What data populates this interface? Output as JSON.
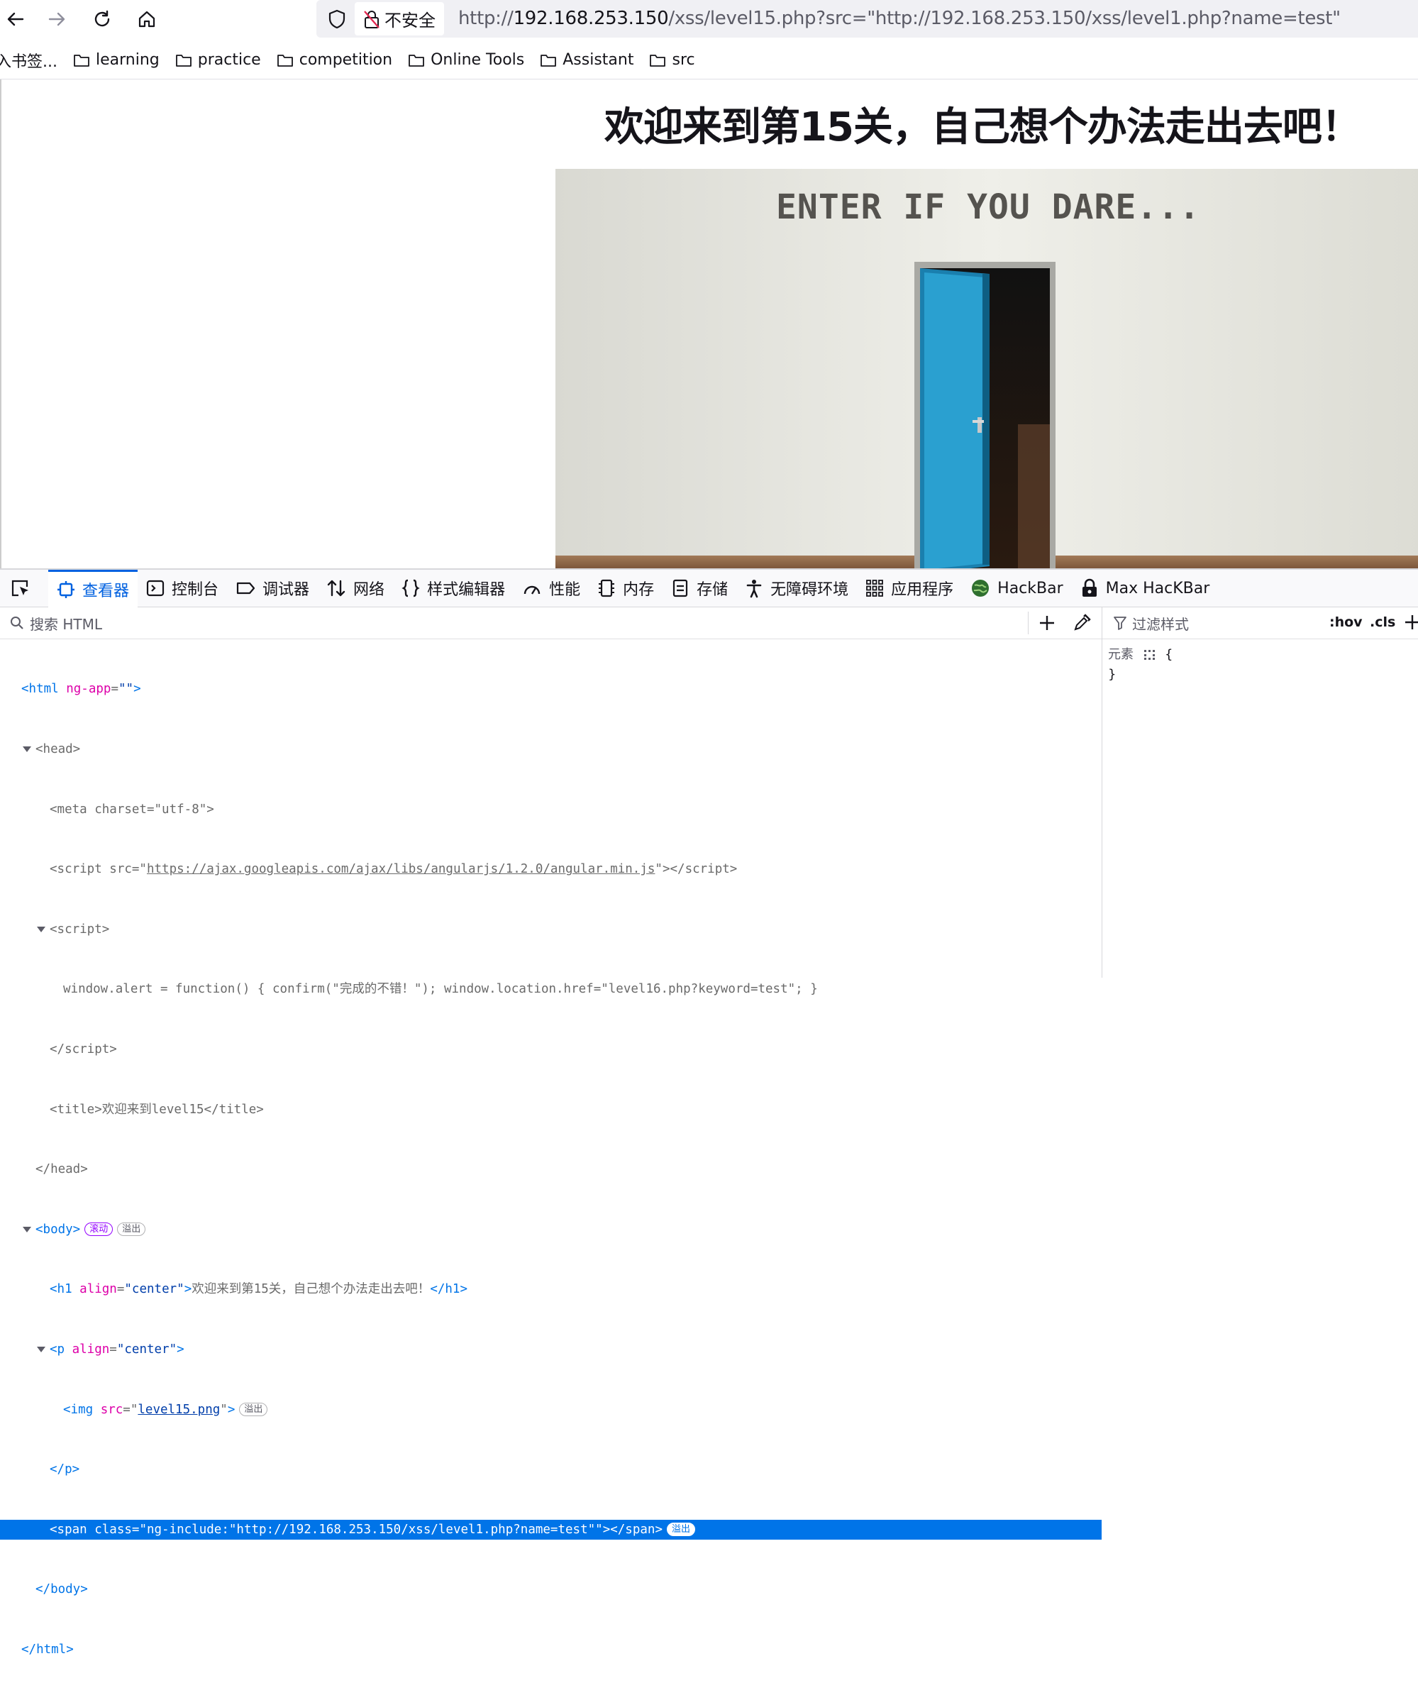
{
  "browser": {
    "insecure_label": "不安全",
    "url_prefix": "http://",
    "url_host": "192.168.253.150",
    "url_rest": "/xss/level15.php?src=\"http://192.168.253.150/xss/level1.php?name=test\""
  },
  "bookmarks": [
    {
      "label": "入书签..."
    },
    {
      "label": "learning"
    },
    {
      "label": "practice"
    },
    {
      "label": "competition"
    },
    {
      "label": "Online Tools"
    },
    {
      "label": "Assistant"
    },
    {
      "label": "src"
    }
  ],
  "page": {
    "heading": "欢迎来到第15关，自己想个办法走出去吧！",
    "image_text": "ENTER IF YOU DARE..."
  },
  "devtools": {
    "tabs": {
      "inspector": "查看器",
      "console": "控制台",
      "debugger": "调试器",
      "network": "网络",
      "style_editor": "样式编辑器",
      "performance": "性能",
      "memory": "内存",
      "storage": "存储",
      "accessibility": "无障碍环境",
      "application": "应用程序",
      "hackbar": "HackBar",
      "max_hackbar": "Max HacKBar"
    },
    "search_placeholder": "搜索 HTML",
    "filter_placeholder": "过滤样式",
    "hov": ":hov",
    "cls": ".cls",
    "rule_selector": "元素",
    "rule_open": "{",
    "rule_close": "}",
    "badges": {
      "scroll": "滚动",
      "overflow": "溢出"
    },
    "tree": {
      "html_attr": "ng-app",
      "html_val": "\"\"",
      "charset_val": "\"utf-8\"",
      "script_src": "https://ajax.googleapis.com/ajax/libs/angularjs/1.2.0/angular.min.js",
      "script_body": "window.alert = function() { confirm(\"完成的不错！\"); window.location.href=\"level16.php?keyword=test\"; }",
      "title_text": "欢迎来到level15",
      "h1_align": "\"center\"",
      "h1_text": "欢迎来到第15关，自己想个办法走出去吧！",
      "p_align": "\"center\"",
      "img_src": "level15.png",
      "span_class": "\"ng-include:\"http://192.168.253.150/xss/level1.php?name=test\"\""
    }
  }
}
